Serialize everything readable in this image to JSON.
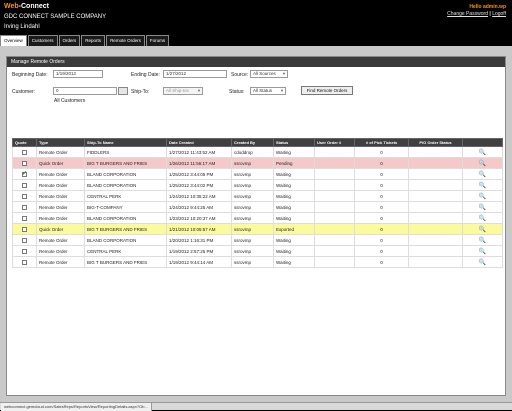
{
  "brand": {
    "part1": "Web",
    "part2": "-Connect"
  },
  "company": "GDC CONNECT SAMPLE COMPANY",
  "user": "Irving Lindahl",
  "header_right": {
    "hello": "Hello admin.wp",
    "change_password": "Change Password",
    "separator": "|",
    "logout": "Logoff"
  },
  "nav": {
    "tabs": [
      "Overview",
      "Customers",
      "Orders",
      "Reports",
      "Remote Orders",
      "Forums"
    ]
  },
  "panel_title": "Manage Remote Orders",
  "filters": {
    "beginning_date_label": "Beginning Date:",
    "beginning_date_value": "1/19/2012",
    "ending_date_label": "Ending Date:",
    "ending_date_value": "1/27/2012",
    "source_label": "Source:",
    "source_value": "All Sources",
    "customer_label": "Customer:",
    "customer_value": "0",
    "all_customers_label": "All Customers",
    "ship_to_label": "Ship-To:",
    "ship_to_value": "All Ship-tos",
    "status_label": "Status:",
    "status_value": "All Status",
    "find_button": "Find Remote Orders"
  },
  "table": {
    "headers": [
      "Quote",
      "Type",
      "Ship-To Name",
      "Date Created",
      "Created By",
      "Status",
      "User Order #",
      "# of Pick Tickets",
      "P/O Order Status",
      ""
    ],
    "rows": [
      {
        "checked": false,
        "type": "Remote Order",
        "ship_to": "FIDDLERS",
        "date": "1/27/2012 11:43:52 AM",
        "created_by": "cdoddrop",
        "status": "Waiting",
        "user_order": "",
        "picks": "0",
        "po_status": "",
        "highlight": ""
      },
      {
        "checked": false,
        "type": "Quick Order",
        "ship_to": "BIG T BURGERS AND FRIES",
        "date": "1/26/2012 11:56:17 AM",
        "created_by": "ssrovmp",
        "status": "Pending",
        "user_order": "",
        "picks": "0",
        "po_status": "",
        "highlight": "pink"
      },
      {
        "checked": true,
        "type": "Remote Order",
        "ship_to": "BLAND CORPORATION",
        "date": "1/25/2012 3:44:05 PM",
        "created_by": "ssrovmp",
        "status": "Waiting",
        "user_order": "",
        "picks": "0",
        "po_status": "",
        "highlight": ""
      },
      {
        "checked": false,
        "type": "Remote Order",
        "ship_to": "BLAND CORPORATION",
        "date": "1/25/2012 3:44:02 PM",
        "created_by": "ssrovmp",
        "status": "Waiting",
        "user_order": "",
        "picks": "0",
        "po_status": "",
        "highlight": ""
      },
      {
        "checked": false,
        "type": "Remote Order",
        "ship_to": "CENTRAL PERK",
        "date": "1/24/2012 10:35:22 AM",
        "created_by": "ssrovmp",
        "status": "Waiting",
        "user_order": "",
        "picks": "0",
        "po_status": "",
        "highlight": ""
      },
      {
        "checked": false,
        "type": "Remote Order",
        "ship_to": "BIG-T-COMPANY",
        "date": "1/24/2012 9:44:25 AM",
        "created_by": "ssrovmp",
        "status": "Waiting",
        "user_order": "",
        "picks": "0",
        "po_status": "",
        "highlight": ""
      },
      {
        "checked": false,
        "type": "Remote Order",
        "ship_to": "BLAND CORPORATION",
        "date": "1/23/2012 10:20:37 AM",
        "created_by": "ssrovmp",
        "status": "Waiting",
        "user_order": "",
        "picks": "0",
        "po_status": "",
        "highlight": ""
      },
      {
        "checked": false,
        "type": "Quick Order",
        "ship_to": "BIG T BURGERS AND FRIES",
        "date": "1/21/2012 10:05:57 AM",
        "created_by": "ssrovmp",
        "status": "Exported",
        "user_order": "",
        "picks": "0",
        "po_status": "",
        "highlight": "yellow"
      },
      {
        "checked": false,
        "type": "Remote Order",
        "ship_to": "BLAND CORPORATION",
        "date": "1/20/2012 1:16:31 PM",
        "created_by": "ssrovmp",
        "status": "Waiting",
        "user_order": "",
        "picks": "0",
        "po_status": "",
        "highlight": ""
      },
      {
        "checked": false,
        "type": "Remote Order",
        "ship_to": "CENTRAL PERK",
        "date": "1/19/2012 2:57:25 PM",
        "created_by": "ssrovmp",
        "status": "Waiting",
        "user_order": "",
        "picks": "0",
        "po_status": "",
        "highlight": ""
      },
      {
        "checked": false,
        "type": "Remote Order",
        "ship_to": "BIG T BURGERS AND FRIES",
        "date": "1/19/2012 9:44:14 AM",
        "created_by": "ssrovmp",
        "status": "Waiting",
        "user_order": "",
        "picks": "0",
        "po_status": "",
        "highlight": ""
      }
    ]
  },
  "icons": {
    "view": "magnifier-icon",
    "lookup": "lookup-icon"
  },
  "colors": {
    "brand_accent": "#f59a00",
    "pending_row": "#f3c9c9",
    "exported_row": "#fbfb9e"
  },
  "status_bar_url": "webconnect.gemcloud.com/SalesReps/ReportsView/ReportingDetails.aspx?Ob..."
}
